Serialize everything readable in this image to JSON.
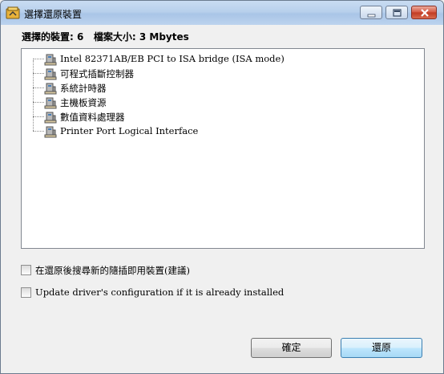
{
  "window": {
    "title": "選擇還原裝置"
  },
  "info": {
    "selected_label": "選擇的裝置: 6",
    "size_label": "檔案大小: 3 Mbytes"
  },
  "devices": [
    "Intel 82371AB/EB PCI to ISA bridge (ISA mode)",
    "可程式插斷控制器",
    "系統計時器",
    "主機板資源",
    "數值資料處理器",
    "Printer Port Logical Interface"
  ],
  "options": {
    "search_pnp": {
      "label": "在還原後搜尋新的隨插即用裝置(建議)",
      "checked": false
    },
    "update_driver": {
      "label": "Update driver's configuration if it is already installed",
      "checked": false
    }
  },
  "buttons": {
    "ok": "確定",
    "restore": "還原"
  },
  "icons": {
    "app": "restore-app-icon",
    "device": "device-icon",
    "minimize": "minimize-icon",
    "maximize": "maximize-icon",
    "close": "close-icon"
  }
}
